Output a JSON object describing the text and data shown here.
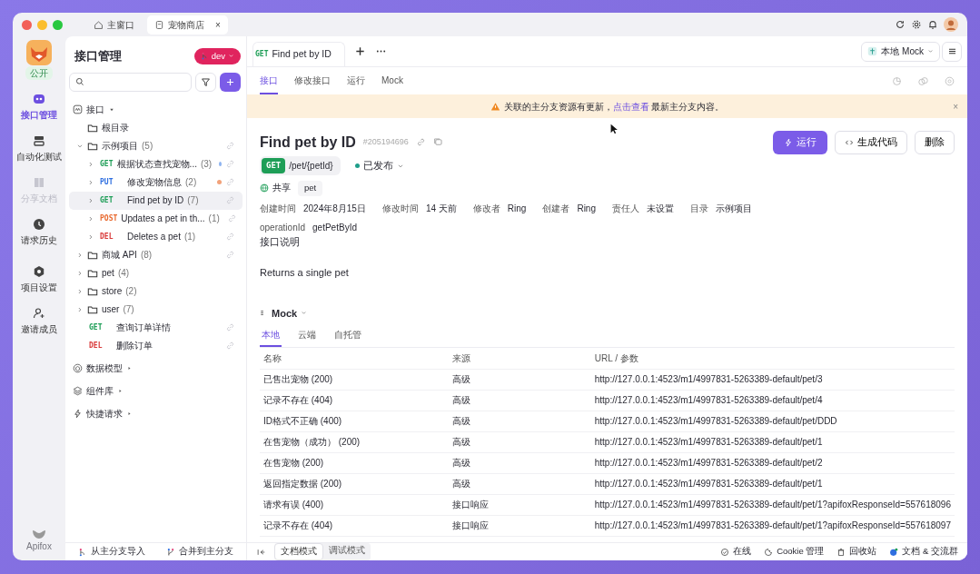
{
  "titlebar": {
    "tabs": [
      {
        "label": "主窗口",
        "selected": false
      },
      {
        "label": "宠物商店",
        "selected": true,
        "close": "×"
      }
    ]
  },
  "rail": {
    "badge": "公开",
    "items": [
      {
        "label": "接口管理",
        "selected": true,
        "disabled": false
      },
      {
        "label": "自动化测试",
        "selected": false,
        "disabled": false
      },
      {
        "label": "分享文档",
        "selected": false,
        "disabled": true
      },
      {
        "label": "请求历史",
        "selected": false,
        "disabled": false
      },
      {
        "label": "项目设置",
        "selected": false,
        "disabled": false
      },
      {
        "label": "邀请成员",
        "selected": false,
        "disabled": false
      }
    ],
    "footer": "Apifox"
  },
  "sidebar": {
    "title": "接口管理",
    "branch": "dev",
    "tree_root": "接口",
    "tree": [
      {
        "kind": "root",
        "label": "根目录"
      },
      {
        "kind": "folder",
        "label": "示例项目",
        "count": "(5)",
        "expanded": true,
        "link": true,
        "children": [
          {
            "kind": "endpoint",
            "method": "GET",
            "color": "#1e9e57",
            "label": "根据状态查找宠物...",
            "count": "(3)",
            "marker": {
              "color": "#8fb4f0"
            },
            "expanded": false,
            "selected": false,
            "link": true
          },
          {
            "kind": "endpoint",
            "method": "PUT",
            "color": "#2f6fe0",
            "label": "修改宠物信息",
            "count": "(2)",
            "marker": {
              "color": "#f2a27a"
            },
            "expanded": false,
            "selected": false,
            "link": true
          },
          {
            "kind": "endpoint",
            "method": "GET",
            "color": "#1e9e57",
            "label": "Find pet by ID",
            "count": "(7)",
            "expanded": false,
            "selected": true,
            "link": true
          },
          {
            "kind": "endpoint",
            "method": "POST",
            "color": "#e8692e",
            "label": "Updates a pet in th...",
            "count": "(1)",
            "expanded": false,
            "selected": false,
            "link": true
          },
          {
            "kind": "endpoint",
            "method": "DEL",
            "color": "#d93a3a",
            "label": "Deletes a pet",
            "count": "(1)",
            "expanded": false,
            "selected": false,
            "link": true
          }
        ]
      },
      {
        "kind": "folder",
        "label": "商城 API",
        "count": "(8)",
        "expanded": false,
        "link": true
      },
      {
        "kind": "folder",
        "label": "pet",
        "count": "(4)",
        "expanded": false,
        "link": false
      },
      {
        "kind": "folder",
        "label": "store",
        "count": "(2)",
        "expanded": false,
        "link": false
      },
      {
        "kind": "folder",
        "label": "user",
        "count": "(7)",
        "expanded": false,
        "link": false
      },
      {
        "kind": "request",
        "method": "GET",
        "color": "#1e9e57",
        "label": "查询订单详情",
        "selected": false,
        "link": true
      },
      {
        "kind": "request",
        "method": "DEL",
        "color": "#d93a3a",
        "label": "删除订单",
        "selected": false,
        "link": true
      }
    ],
    "sections": [
      {
        "label": "数据模型"
      },
      {
        "label": "组件库"
      },
      {
        "label": "快捷请求"
      }
    ],
    "footer": [
      {
        "label": "从主分支导入"
      },
      {
        "label": "合并到主分支"
      }
    ]
  },
  "main": {
    "tabs": [
      {
        "method": "GET",
        "color": "#1e9e57",
        "label": "Find pet by ID",
        "selected": true
      }
    ],
    "environment": "本地 Mock",
    "subtabs": [
      {
        "label": "接口",
        "selected": true
      },
      {
        "label": "修改接口",
        "selected": false
      },
      {
        "label": "运行",
        "selected": false
      },
      {
        "label": "Mock",
        "selected": false
      }
    ],
    "banner": {
      "text": "关联的主分支资源有更新，",
      "link": "点击查看",
      "text_after": "最新主分支内容。",
      "close": "×"
    },
    "title": "Find pet by ID",
    "id": "#205194696",
    "actions": [
      {
        "label": "运行",
        "kind": "primary"
      },
      {
        "label": "生成代码",
        "kind": "outline"
      },
      {
        "label": "删除",
        "kind": "outline"
      }
    ],
    "method": {
      "label": "GET",
      "color": "#1e9e57"
    },
    "path": "/pet/{petId}",
    "status": {
      "label": "已发布",
      "color": "#1e9e8a"
    },
    "visibility": "共享",
    "tag": "pet",
    "meta": [
      {
        "label": "创建时间",
        "value": "2024年8月15日"
      },
      {
        "label": "修改时间",
        "value": "14 天前"
      },
      {
        "label": "修改者",
        "value": "Ring"
      },
      {
        "label": "创建者",
        "value": "Ring"
      },
      {
        "label": "责任人",
        "value": "未设置"
      },
      {
        "label": "目录",
        "value": "示例项目"
      }
    ],
    "operation": {
      "label": "operationId",
      "value": "getPetById"
    },
    "description_title": "接口说明",
    "description": "Returns a single pet",
    "mock": {
      "title": "Mock",
      "tabs": [
        {
          "label": "本地",
          "selected": true
        },
        {
          "label": "云端",
          "selected": false
        },
        {
          "label": "自托管",
          "selected": false
        }
      ],
      "columns": [
        "名称",
        "来源",
        "URL / 参数"
      ],
      "rows": [
        [
          "已售出宠物 (200)",
          "高级",
          "http://127.0.0.1:4523/m1/4997831-5263389-default/pet/3"
        ],
        [
          "记录不存在 (404)",
          "高级",
          "http://127.0.0.1:4523/m1/4997831-5263389-default/pet/4"
        ],
        [
          "ID格式不正确 (400)",
          "高级",
          "http://127.0.0.1:4523/m1/4997831-5263389-default/pet/DDD"
        ],
        [
          "在售宠物（成功） (200)",
          "高级",
          "http://127.0.0.1:4523/m1/4997831-5263389-default/pet/1"
        ],
        [
          "在售宠物 (200)",
          "高级",
          "http://127.0.0.1:4523/m1/4997831-5263389-default/pet/2"
        ],
        [
          "返回指定数据 (200)",
          "高级",
          "http://127.0.0.1:4523/m1/4997831-5263389-default/pet/1"
        ],
        [
          "请求有误 (400)",
          "接口响应",
          "http://127.0.0.1:4523/m1/4997831-5263389-default/pet/1?apifoxResponseId=557618096"
        ],
        [
          "记录不存在 (404)",
          "接口响应",
          "http://127.0.0.1:4523/m1/4997831-5263389-default/pet/1?apifoxResponseId=557618097"
        ]
      ]
    }
  },
  "statusbar": {
    "modes": [
      {
        "label": "文档模式",
        "selected": true
      },
      {
        "label": "调试模式",
        "selected": false
      }
    ],
    "items": [
      {
        "label": "在线"
      },
      {
        "label": "Cookie 管理"
      },
      {
        "label": "回收站"
      },
      {
        "label": "文档 & 交流群"
      }
    ]
  }
}
